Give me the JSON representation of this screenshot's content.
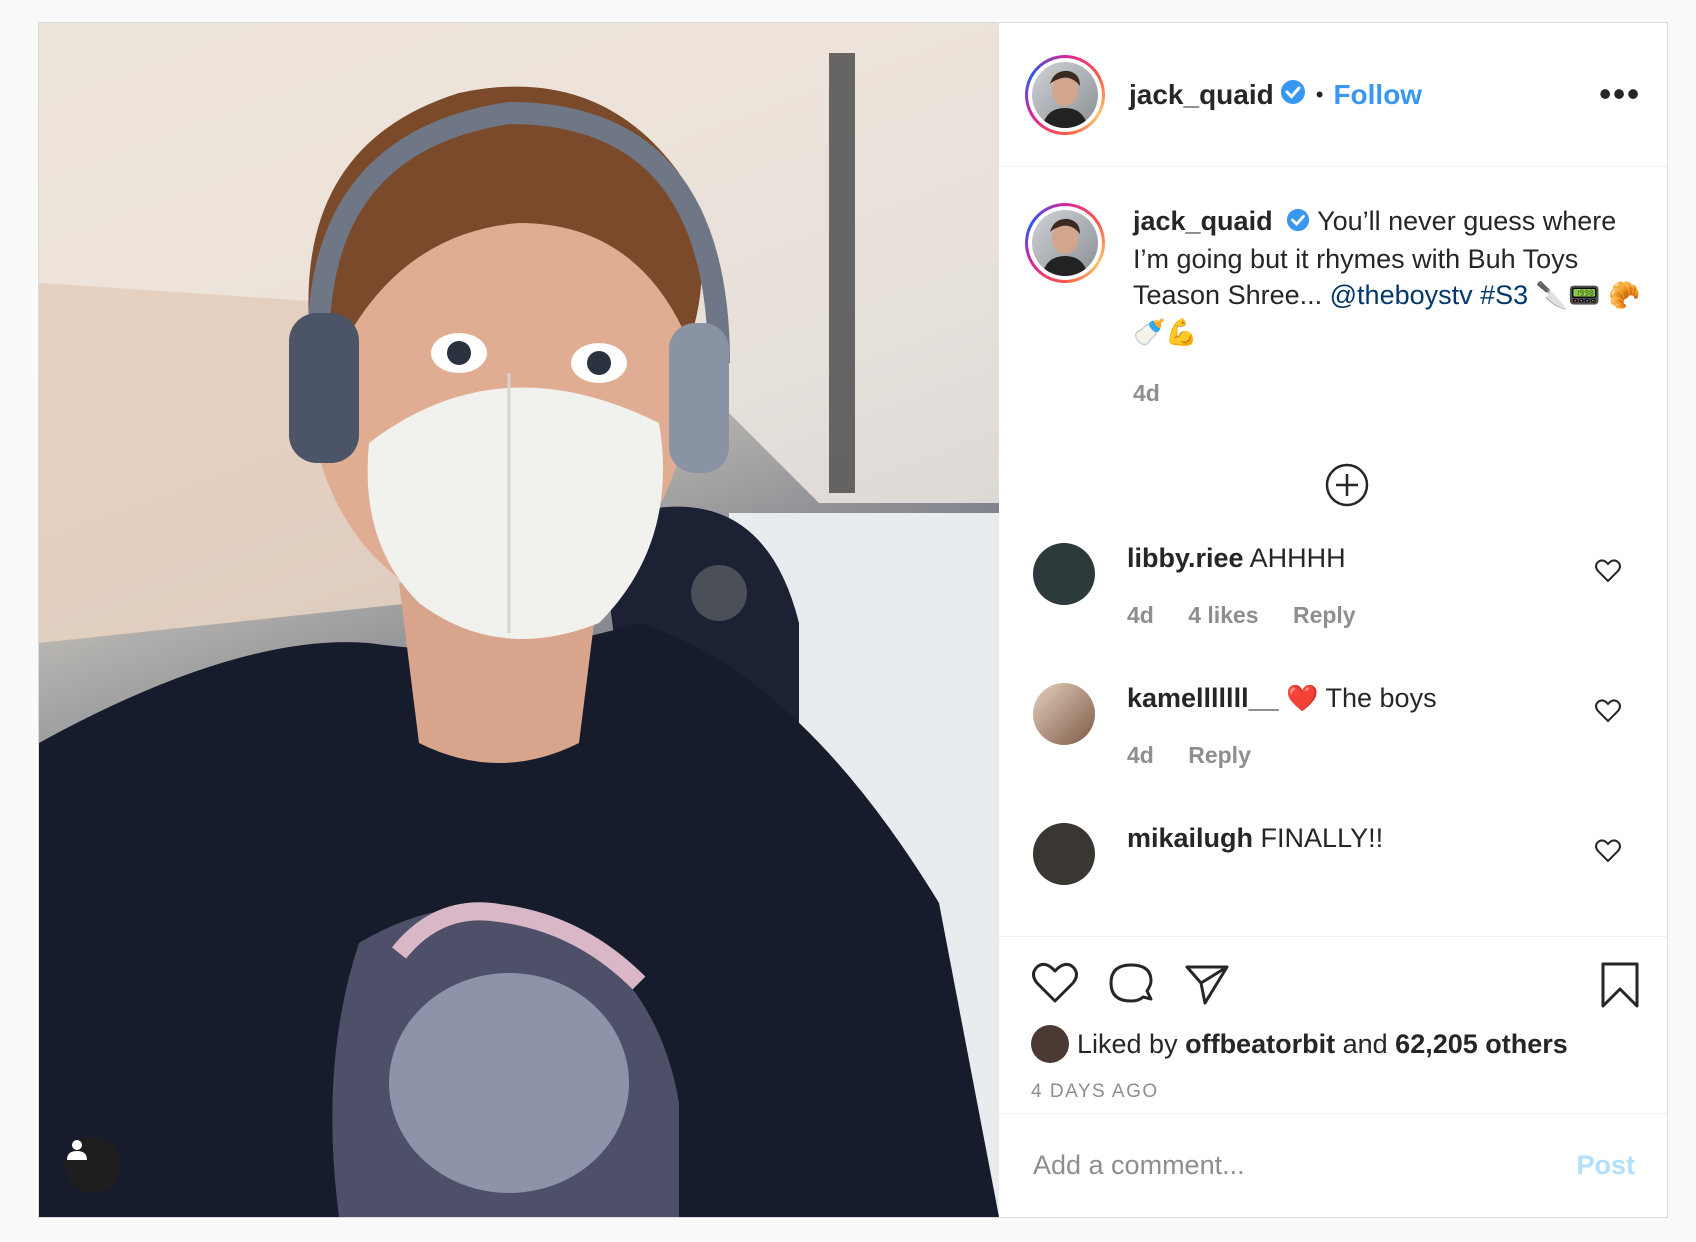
{
  "post": {
    "author": {
      "username": "jack_quaid",
      "follow_label": "Follow",
      "separator": "•",
      "more_label": "•••"
    },
    "caption": {
      "username": "jack_quaid",
      "text": "You’ll never guess where I’m going but it rhymes with Buh Toys Teason Shree...",
      "mention": "@theboystv",
      "hashtag": "#S3",
      "emoji_line1": "🔪📟",
      "emoji_line2": "🥐🍼💪",
      "time": "4d"
    },
    "load_more_icon": "plus-circle-icon",
    "comments": [
      {
        "username": "libby.riee",
        "text": "AHHHH",
        "time": "4d",
        "likes": "4 likes",
        "reply": "Reply",
        "avatar_color": "#2d3a3c"
      },
      {
        "username": "kamelllllll__",
        "emoji": "❤️",
        "text": "The boys",
        "time": "4d",
        "reply": "Reply",
        "avatar_color": "#c9a98a"
      },
      {
        "username": "mikailugh",
        "text": "FINALLY!!",
        "avatar_color": "#3a3632"
      }
    ],
    "likes": {
      "prefix": "Liked by",
      "user": "offbeatorbit",
      "and": "and",
      "count": "62,205 others"
    },
    "timestamp": "4 DAYS AGO",
    "add_comment": {
      "placeholder": "Add a comment...",
      "post_label": "Post"
    },
    "colors": {
      "link": "#00376b",
      "follow": "#3897f0",
      "post_disabled": "#b2dffc",
      "verified": "#3897f0"
    }
  }
}
